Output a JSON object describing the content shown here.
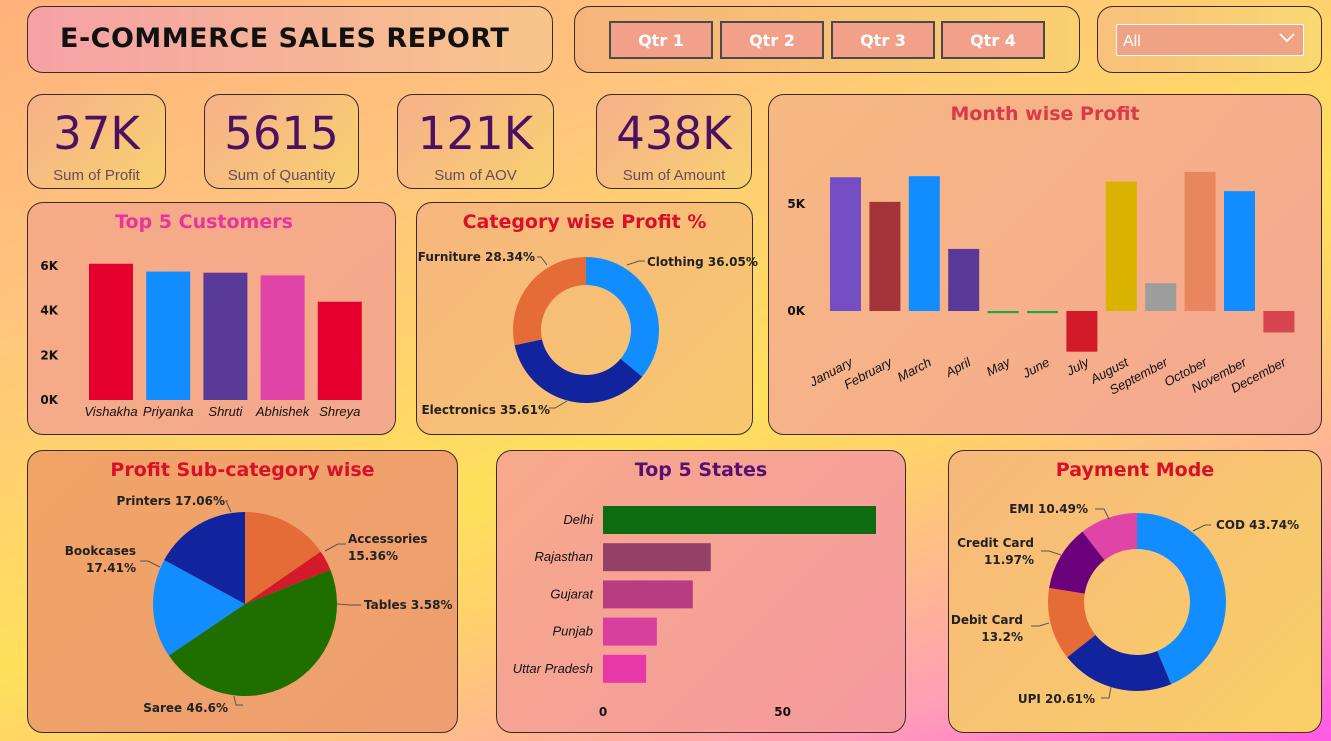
{
  "header": {
    "title": "E-COMMERCE SALES REPORT"
  },
  "quarters": [
    "Qtr 1",
    "Qtr 2",
    "Qtr 3",
    "Qtr 4"
  ],
  "filter": {
    "selected": "All"
  },
  "kpis": [
    {
      "value": "37K",
      "label": "Sum of Profit"
    },
    {
      "value": "5615",
      "label": "Sum of Quantity"
    },
    {
      "value": "121K",
      "label": "Sum of AOV"
    },
    {
      "value": "438K",
      "label": "Sum of Amount"
    }
  ],
  "titles": {
    "customers": "Top 5 Customers",
    "category": "Category wise Profit %",
    "month": "Month wise Profit",
    "subcat": "Profit Sub-category wise",
    "states": "Top 5 States",
    "payment": "Payment Mode"
  },
  "title_colors": {
    "customers": "#e8359e",
    "category": "#d8102a",
    "month": "#d83a4a",
    "subcat": "#d8102a",
    "states": "#5a1070",
    "payment": "#d8102a"
  },
  "chart_data": [
    {
      "id": "customers",
      "type": "bar",
      "categories": [
        "Vishakha",
        "Priyanka",
        "Shruti",
        "Abhishek",
        "Shreya"
      ],
      "values": [
        6100,
        5750,
        5700,
        5580,
        4400
      ],
      "colors": [
        "#e5002f",
        "#118dff",
        "#5a3a99",
        "#e044a7",
        "#e5002f"
      ],
      "ylim": [
        0,
        6000
      ],
      "yticks": [
        "0K",
        "2K",
        "4K",
        "6K"
      ],
      "ytick_values": [
        0,
        2000,
        4000,
        6000
      ]
    },
    {
      "id": "category",
      "type": "pie",
      "donut": true,
      "slices": [
        {
          "label": "Clothing",
          "pct_label": "Clothing 36.05%",
          "value": 36.05,
          "color": "#118dff"
        },
        {
          "label": "Electronics",
          "pct_label": "Electronics 35.61%",
          "value": 35.61,
          "color": "#12239e"
        },
        {
          "label": "Furniture",
          "pct_label": "Furniture 28.34%",
          "value": 28.34,
          "color": "#e66c37"
        }
      ]
    },
    {
      "id": "month",
      "type": "bar",
      "categories": [
        "January",
        "February",
        "March",
        "April",
        "May",
        "June",
        "July",
        "August",
        "September",
        "October",
        "November",
        "December"
      ],
      "values": [
        6250,
        5100,
        6300,
        2900,
        -100,
        -100,
        -1900,
        6050,
        1300,
        6500,
        5600,
        -1000
      ],
      "colors": [
        "#744ec2",
        "#a4343a",
        "#118dff",
        "#5a3a99",
        "#1aab40",
        "#1aab40",
        "#d21a2a",
        "#d9b300",
        "#9e9e9e",
        "#e8875f",
        "#118dff",
        "#d64550"
      ],
      "yticks": [
        "0K",
        "5K"
      ],
      "ytick_values": [
        0,
        5000
      ]
    },
    {
      "id": "subcat",
      "type": "pie",
      "slices": [
        {
          "label": "Accessories",
          "pct_label": [
            "Accessories",
            "15.36%"
          ],
          "value": 15.36,
          "color": "#e66c37"
        },
        {
          "label": "Tables",
          "pct_label": "Tables 3.58%",
          "value": 3.58,
          "color": "#d21a2a"
        },
        {
          "label": "Saree",
          "pct_label": "Saree 46.6%",
          "value": 46.6,
          "color": "#1e6e00"
        },
        {
          "label": "Bookcases",
          "pct_label": [
            "Bookcases",
            "17.41%"
          ],
          "value": 17.41,
          "color": "#118dff"
        },
        {
          "label": "Printers",
          "pct_label": "Printers 17.06%",
          "value": 17.06,
          "color": "#12239e"
        }
      ]
    },
    {
      "id": "states",
      "type": "bar",
      "orientation": "horizontal",
      "categories": [
        "Delhi",
        "Rajasthan",
        "Gujarat",
        "Punjab",
        "Uttar Pradesh"
      ],
      "values": [
        76,
        30,
        25,
        15,
        12
      ],
      "colors": [
        "#0d6b12",
        "#944168",
        "#b83c82",
        "#d9409e",
        "#e838a8"
      ],
      "xticks": [
        "0",
        "50"
      ],
      "xtick_values": [
        0,
        50
      ],
      "xlim": [
        0,
        76
      ]
    },
    {
      "id": "payment",
      "type": "pie",
      "donut": true,
      "slices": [
        {
          "label": "COD",
          "pct_label": "COD 43.74%",
          "value": 43.74,
          "color": "#118dff"
        },
        {
          "label": "UPI",
          "pct_label": "UPI 20.61%",
          "value": 20.61,
          "color": "#12239e"
        },
        {
          "label": "Debit Card",
          "pct_label": [
            "Debit Card",
            "13.2%"
          ],
          "value": 13.2,
          "color": "#e66c37"
        },
        {
          "label": "Credit Card",
          "pct_label": [
            "Credit Card",
            "11.97%"
          ],
          "value": 11.97,
          "color": "#6b007b"
        },
        {
          "label": "EMI",
          "pct_label": "EMI 10.49%",
          "value": 10.49,
          "color": "#e044a7"
        }
      ]
    }
  ]
}
